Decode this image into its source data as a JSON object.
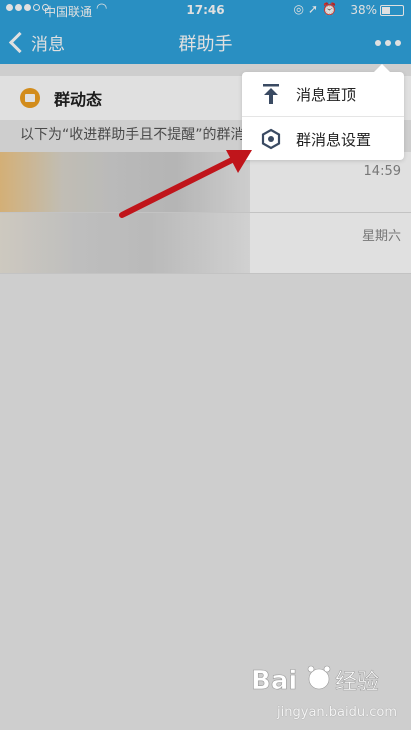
{
  "status_bar": {
    "carrier": "中国联通",
    "time": "17:46",
    "battery": "38%",
    "battery_level": 0.38
  },
  "nav": {
    "back_label": "消息",
    "title": "群助手"
  },
  "group_row": {
    "label": "群动态"
  },
  "notice": "以下为“收进群助手且不提醒”的群消",
  "conversations": [
    {
      "time": "14:59"
    },
    {
      "time": "星期六"
    }
  ],
  "menu": {
    "items": [
      {
        "label": "消息置顶",
        "icon": "pin-top-icon"
      },
      {
        "label": "群消息设置",
        "icon": "settings-hexagon-icon"
      }
    ]
  },
  "watermark": {
    "text": "jingyan.baidu.com"
  },
  "colors": {
    "nav_bg": "#2fa3dd",
    "arrow": "#c0151b",
    "group_icon": "#f0a020"
  }
}
